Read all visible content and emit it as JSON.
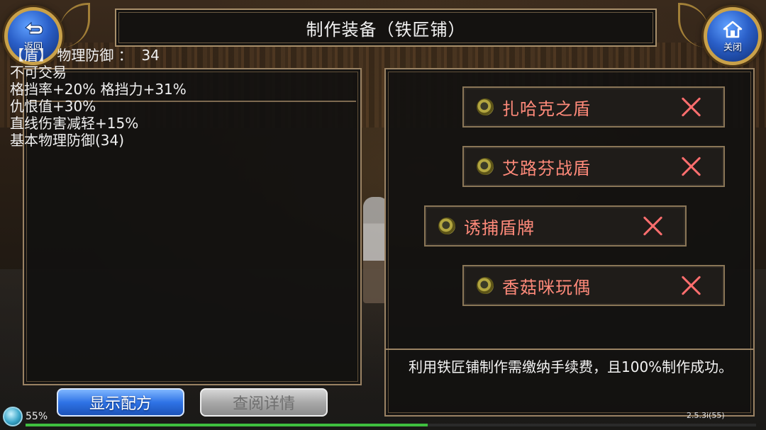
{
  "header": {
    "title": "制作装备（铁匠铺）",
    "back_label": "返回",
    "close_label": "关闭"
  },
  "item_details": {
    "lines": [
      "【盾】 物理防御 ：  34",
      "不可交易",
      "格挡率+20% 格挡力+31%",
      "仇恨值+30%",
      "直线伤害减轻+15%",
      "基本物理防御(34)"
    ]
  },
  "recipes": [
    {
      "name": "扎哈克之盾",
      "icon": "shield-ring-icon"
    },
    {
      "name": "艾路芬战盾",
      "icon": "shield-ring-icon"
    },
    {
      "name": "诱捕盾牌",
      "icon": "shield-ring-icon"
    },
    {
      "name": "香菇咪玩偶",
      "icon": "shield-ring-icon"
    }
  ],
  "note": "利用铁匠铺制作需缴纳手续费，且100%制作成功。",
  "buttons": {
    "show_recipe": "显示配方",
    "view_details": "查阅详情"
  },
  "status": {
    "percent": "55%",
    "progress_fraction": 0.55,
    "version": "2.5.3i(55)"
  },
  "colors": {
    "accent_gold": "#c9a14a",
    "recipe_text": "#ff8a7a",
    "button_blue": "#2f73e6"
  }
}
